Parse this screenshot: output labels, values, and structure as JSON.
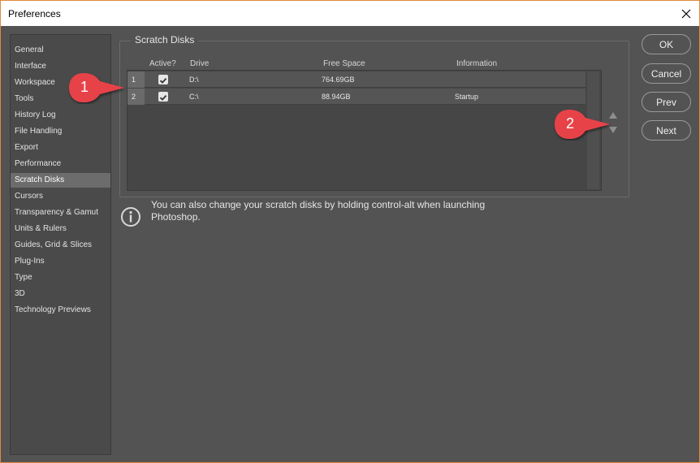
{
  "window": {
    "title": "Preferences"
  },
  "sidebar": {
    "items": [
      {
        "label": "General"
      },
      {
        "label": "Interface"
      },
      {
        "label": "Workspace"
      },
      {
        "label": "Tools"
      },
      {
        "label": "History Log"
      },
      {
        "label": "File Handling"
      },
      {
        "label": "Export"
      },
      {
        "label": "Performance"
      },
      {
        "label": "Scratch Disks"
      },
      {
        "label": "Cursors"
      },
      {
        "label": "Transparency & Gamut"
      },
      {
        "label": "Units & Rulers"
      },
      {
        "label": "Guides, Grid & Slices"
      },
      {
        "label": "Plug-Ins"
      },
      {
        "label": "Type"
      },
      {
        "label": "3D"
      },
      {
        "label": "Technology Previews"
      }
    ],
    "selected": "Scratch Disks"
  },
  "scratch": {
    "group_title": "Scratch Disks",
    "columns": [
      "Active?",
      "Drive",
      "Free Space",
      "Information"
    ],
    "rows": [
      {
        "num": "1",
        "active": true,
        "drive": "D:\\",
        "free": "764.69GB",
        "info": ""
      },
      {
        "num": "2",
        "active": true,
        "drive": "C:\\",
        "free": "88.94GB",
        "info": "Startup"
      }
    ]
  },
  "info_text": "You can also change your scratch disks by holding control-alt when launching Photoshop.",
  "buttons": {
    "ok": "OK",
    "cancel": "Cancel",
    "prev": "Prev",
    "next": "Next"
  },
  "callouts": [
    "1",
    "2"
  ],
  "colors": {
    "callout": "#e8424a",
    "accent_border": "#e08a3c"
  }
}
